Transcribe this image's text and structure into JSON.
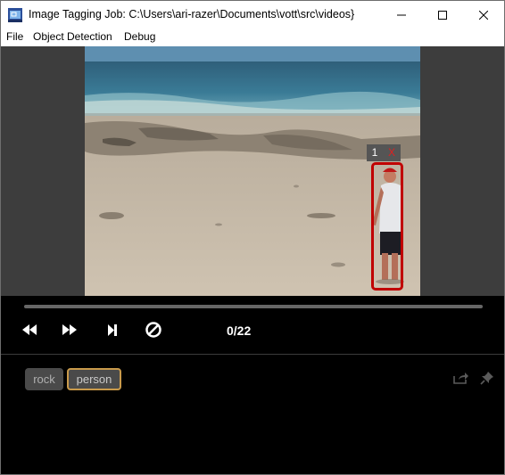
{
  "window": {
    "title": "Image Tagging Job: C:\\Users\\ari-razer\\Documents\\vott\\src\\videos}",
    "icon": "vott-app-icon",
    "controls": [
      "minimize-icon",
      "maximize-icon",
      "close-icon"
    ]
  },
  "menu": {
    "file": "File",
    "object_detection": "Object Detection",
    "debug": "Debug"
  },
  "region": {
    "id": "1",
    "delete_label": "X",
    "color": "#c00000"
  },
  "player": {
    "frame_counter": "0/22",
    "progress": 0,
    "buttons": [
      "rewind-icon",
      "fast-forward-icon",
      "step-forward-icon",
      "clear-icon"
    ]
  },
  "tags": {
    "items": [
      {
        "label": "rock",
        "selected": false
      },
      {
        "label": "person",
        "selected": true
      }
    ],
    "selected_color": "#c99a4b",
    "tools": [
      "export-icon",
      "pin-icon"
    ]
  }
}
